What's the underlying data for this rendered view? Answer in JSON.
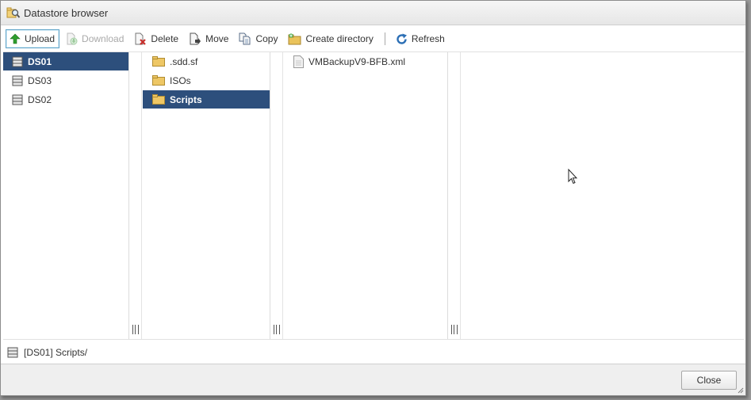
{
  "window": {
    "title": "Datastore browser",
    "icon": "datastore-search-icon"
  },
  "toolbar": {
    "upload": {
      "label": "Upload",
      "icon": "upload-arrow-icon",
      "enabled": true
    },
    "download": {
      "label": "Download",
      "icon": "download-icon",
      "enabled": false
    },
    "delete": {
      "label": "Delete",
      "icon": "delete-icon",
      "enabled": true
    },
    "move": {
      "label": "Move",
      "icon": "move-icon",
      "enabled": true
    },
    "copy": {
      "label": "Copy",
      "icon": "copy-icon",
      "enabled": true
    },
    "create_directory": {
      "label": "Create directory",
      "icon": "new-folder-icon",
      "enabled": true
    },
    "refresh": {
      "label": "Refresh",
      "icon": "refresh-icon",
      "enabled": true
    }
  },
  "datastores": [
    {
      "name": "DS01",
      "selected": true
    },
    {
      "name": "DS03",
      "selected": false
    },
    {
      "name": "DS02",
      "selected": false
    }
  ],
  "folders": [
    {
      "name": ".sdd.sf",
      "selected": false
    },
    {
      "name": "ISOs",
      "selected": false
    },
    {
      "name": "Scripts",
      "selected": true
    }
  ],
  "files": [
    {
      "name": "VMBackupV9-BFB.xml",
      "selected": false
    }
  ],
  "status": {
    "path": "[DS01] Scripts/"
  },
  "footer": {
    "close_label": "Close"
  },
  "colors": {
    "selection": "#2d4f7c",
    "folder": "#e9c25a",
    "upload_green": "#2e9e2e",
    "refresh_blue": "#2c6fb5",
    "delete_red": "#c9302c"
  }
}
